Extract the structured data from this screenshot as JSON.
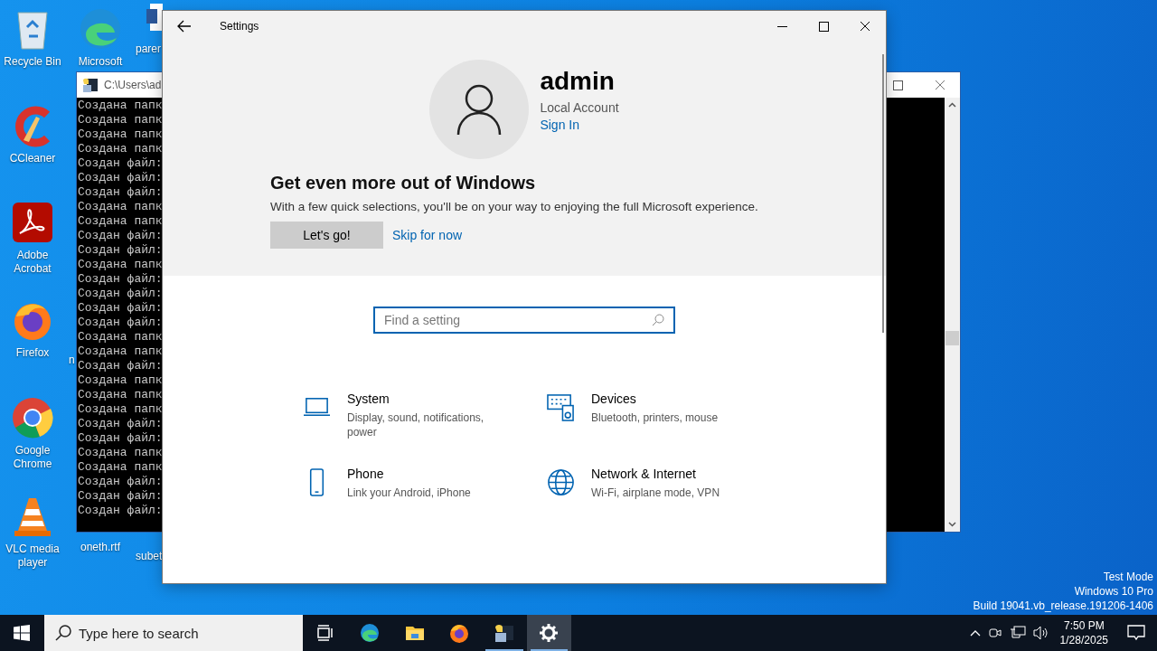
{
  "desktop_icons": [
    {
      "label": "Recycle Bin",
      "kind": "recycle"
    },
    {
      "label": "CCleaner",
      "kind": "ccleaner"
    },
    {
      "label": "Adobe Acrobat",
      "kind": "acrobat"
    },
    {
      "label": "Firefox",
      "kind": "firefox"
    },
    {
      "label": "Google Chrome",
      "kind": "chrome"
    },
    {
      "label": "VLC media player",
      "kind": "vlc"
    },
    {
      "label": "Microsoft",
      "kind": "edge"
    },
    {
      "label": "parer",
      "kind": "document"
    },
    {
      "label": "n",
      "kind": "hidden"
    },
    {
      "label": "oneth.rtf",
      "kind": "hidden"
    },
    {
      "label": "subet",
      "kind": "hidden"
    }
  ],
  "desktop_notice": [
    "Test Mode",
    "Windows 10 Pro",
    "Build 19041.vb_release.191206-1406"
  ],
  "console": {
    "title": "C:\\Users\\ad",
    "lines": [
      "Создана папк",
      "Создана папк",
      "Создана папк",
      "Создана папк",
      "Создан файл:",
      "Создан файл:",
      "Создан файл:",
      "Создана папк",
      "Создана папк",
      "Создан файл:",
      "Создан файл:",
      "Создана папк",
      "Создан файл:",
      "Создан файл:",
      "Создан файл:",
      "Создан файл:",
      "Создана папк",
      "Создана папк",
      "Создан файл:",
      "Создана папк",
      "Создана папк",
      "Создана папк",
      "Создан файл:",
      "Создан файл:",
      "Создана папк",
      "Создана папк",
      "Создан файл:",
      "Создан файл:",
      "Создан файл:"
    ]
  },
  "settings": {
    "title": "Settings",
    "account": {
      "name": "admin",
      "type": "Local Account",
      "link": "Sign In"
    },
    "promo": {
      "title": "Get even more out of Windows",
      "text": "With a few quick selections, you'll be on your way to enjoying the full Microsoft experience.",
      "button": "Let's go!",
      "link": "Skip for now"
    },
    "search": {
      "placeholder": "Find a setting"
    },
    "categories": [
      {
        "title": "System",
        "description": "Display, sound, notifications, power",
        "kind": "laptop"
      },
      {
        "title": "Devices",
        "description": "Bluetooth, printers, mouse",
        "kind": "devices"
      },
      {
        "title": "Phone",
        "description": "Link your Android, iPhone",
        "kind": "phone"
      },
      {
        "title": "Network & Internet",
        "description": "Wi-Fi, airplane mode, VPN",
        "kind": "globe"
      }
    ]
  },
  "taskbar": {
    "search_placeholder": "Type here to search",
    "apps": [
      {
        "kind": "edge",
        "running": false,
        "selected": false
      },
      {
        "kind": "explorer",
        "running": false,
        "selected": false
      },
      {
        "kind": "firefox",
        "running": false,
        "selected": false
      },
      {
        "kind": "python",
        "running": true,
        "selected": false
      },
      {
        "kind": "settings",
        "running": true,
        "selected": true
      }
    ],
    "time": "7:50 PM",
    "date": "1/28/2025"
  }
}
